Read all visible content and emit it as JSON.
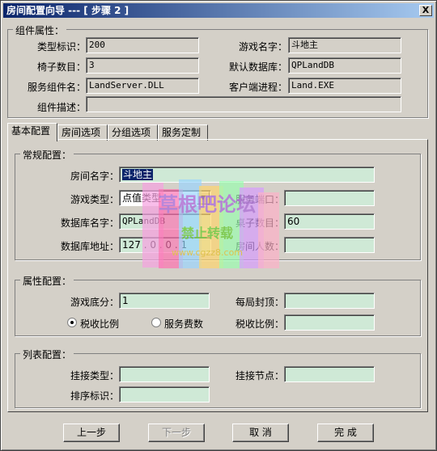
{
  "window": {
    "title": "房间配置向导 --- [ 步骤 2 ]",
    "close_label": "X"
  },
  "component": {
    "group_title": "组件属性：",
    "type_id_label": "类型标识：",
    "type_id": "200",
    "game_name_label": "游戏名字：",
    "game_name": "斗地主",
    "chairs_label": "椅子数目：",
    "chairs": "3",
    "default_db_label": "默认数据库：",
    "default_db": "QPLandDB",
    "service_name_label": "服务组件名：",
    "service_name": "LandServer.DLL",
    "client_process_label": "客户端进程：",
    "client_process": "Land.EXE",
    "desc_label": "组件描述：",
    "desc": ""
  },
  "tabs": [
    "基本配置",
    "房间选项",
    "分组选项",
    "服务定制"
  ],
  "general": {
    "group_title": "常规配置：",
    "room_name_label": "房间名字：",
    "room_name": "斗地主",
    "game_type_label": "游戏类型：",
    "game_type": "点值类型",
    "service_port_label": "服务端口：",
    "service_port": "",
    "db_name_label": "数据库名字：",
    "db_name": "QPLandDB",
    "table_count_label": "桌子数目：",
    "table_count": "60",
    "db_addr_label": "数据库地址：",
    "db_addr": "127 . 0 . 0 . 1",
    "room_people_label": "房间人数：",
    "room_people": ""
  },
  "attributes": {
    "group_title": "属性配置：",
    "base_score_label": "游戏底分：",
    "base_score": "1",
    "cap_label": "每局封顶：",
    "cap": "",
    "tax_ratio_radio_label": "税收比例",
    "service_fee_radio_label": "服务费数",
    "tax_ratio_label": "税收比例：",
    "tax_ratio": ""
  },
  "list_config": {
    "group_title": "列表配置：",
    "mount_type_label": "挂接类型：",
    "mount_type": "",
    "mount_node_label": "挂接节点：",
    "mount_node": "",
    "sort_id_label": "排序标识：",
    "sort_id": ""
  },
  "buttons": {
    "prev": "上一步",
    "next": "下一步",
    "cancel": "取 消",
    "finish": "完 成"
  },
  "watermark": {
    "line1": "草根吧论坛",
    "line2": "禁止转载",
    "line3": "www.cgzz8.com"
  }
}
